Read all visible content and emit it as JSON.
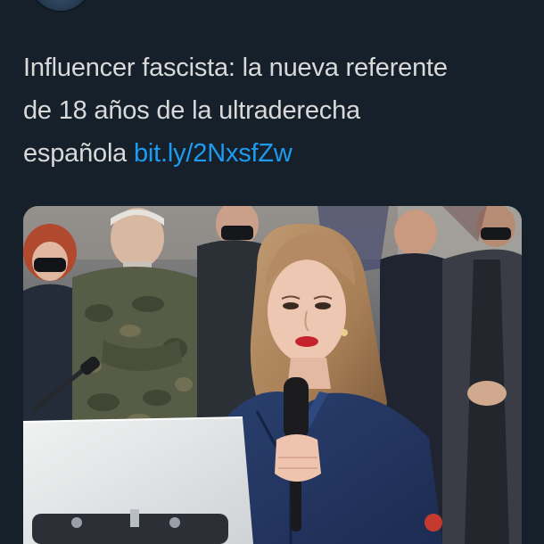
{
  "tweet": {
    "text_lines": [
      "Influencer fascista: la nueva referente",
      "de 18 años de la ultraderecha",
      "española"
    ],
    "link_text": "bit.ly/2NxsfZw"
  },
  "media": {
    "icon": "video-thumbnail"
  },
  "colors": {
    "background": "#15202b",
    "text": "#d9d9d9",
    "link": "#1d9bf0"
  }
}
